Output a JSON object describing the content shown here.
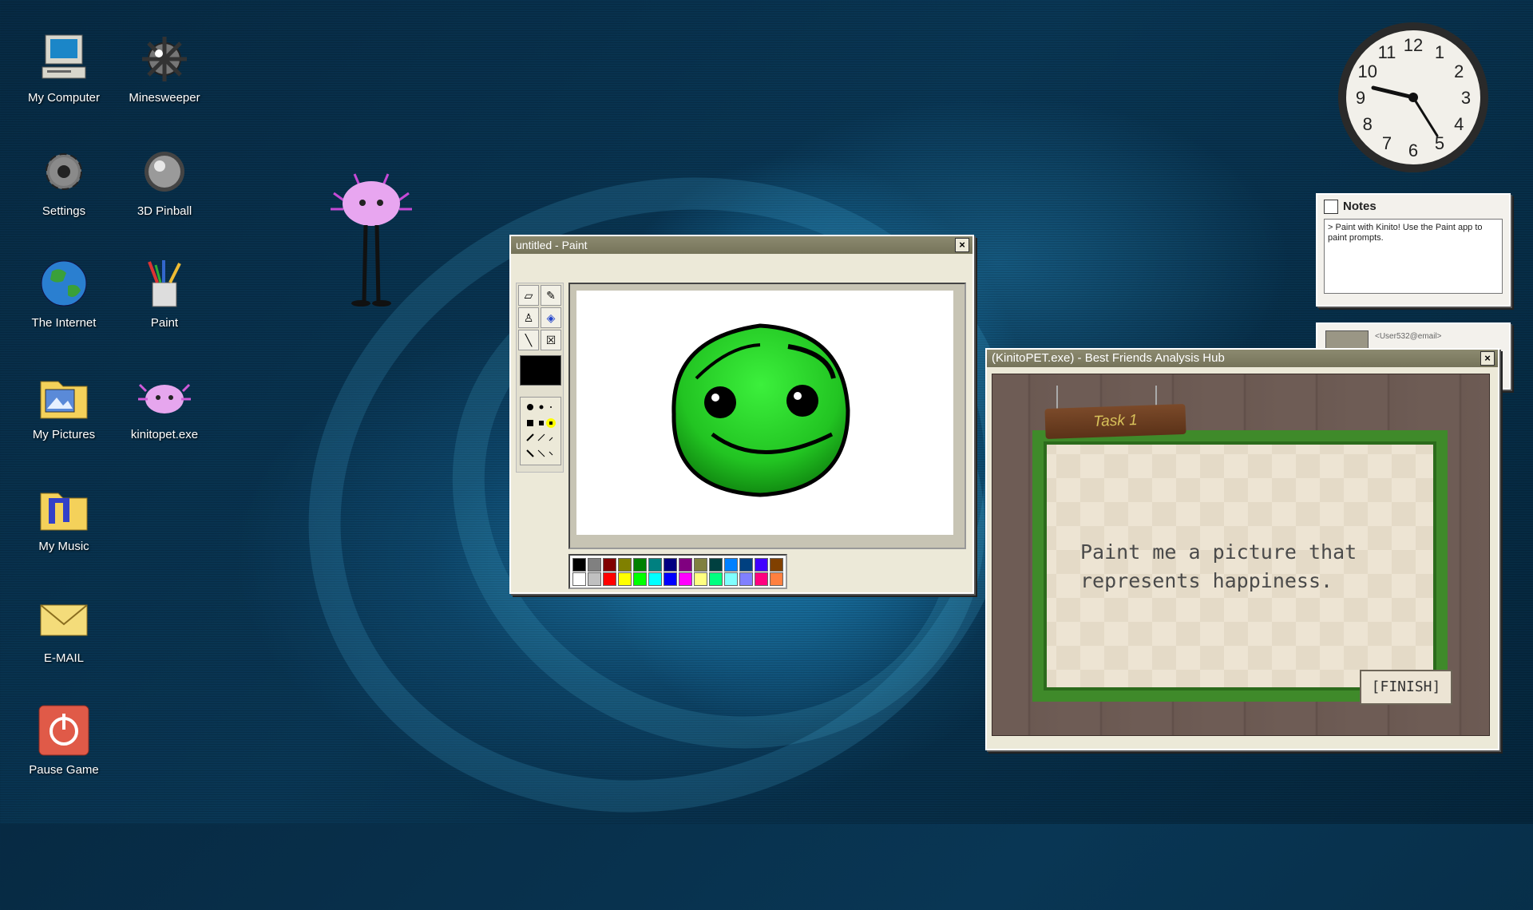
{
  "desktop": {
    "icons": [
      {
        "label": "My Computer"
      },
      {
        "label": "Minesweeper"
      },
      {
        "label": "Settings"
      },
      {
        "label": "3D Pinball"
      },
      {
        "label": "The Internet"
      },
      {
        "label": "Paint"
      },
      {
        "label": "My Pictures"
      },
      {
        "label": "kinitopet.exe"
      },
      {
        "label": "My Music"
      },
      {
        "label": "E-MAIL"
      },
      {
        "label": "Pause Game"
      }
    ]
  },
  "clock": {
    "numbers": [
      "12",
      "1",
      "2",
      "3",
      "4",
      "5",
      "6",
      "7",
      "8",
      "9",
      "10",
      "11"
    ],
    "time_shown": "4:46"
  },
  "notes": {
    "title": "Notes",
    "text": "> Paint with Kinito! Use the Paint app to paint prompts."
  },
  "email_widget": {
    "from": "<User532@email>"
  },
  "paint": {
    "title": "untitled - Paint",
    "close": "×",
    "palette_top": [
      "#000000",
      "#808080",
      "#800000",
      "#808000",
      "#008000",
      "#008080",
      "#000080",
      "#800080",
      "#808040",
      "#004040",
      "#0080ff",
      "#004080",
      "#4000ff",
      "#804000"
    ],
    "palette_bottom": [
      "#ffffff",
      "#c0c0c0",
      "#ff0000",
      "#ffff00",
      "#00ff00",
      "#00ffff",
      "#0000ff",
      "#ff00ff",
      "#ffff80",
      "#00ff80",
      "#80ffff",
      "#8080ff",
      "#ff0080",
      "#ff8040"
    ]
  },
  "kinito": {
    "title": "(KinitoPET.exe) - Best Friends Analysis Hub",
    "close": "×",
    "task": "Task 1",
    "prompt": "Paint me a picture that represents happiness.",
    "finish": "[FINISH]"
  }
}
